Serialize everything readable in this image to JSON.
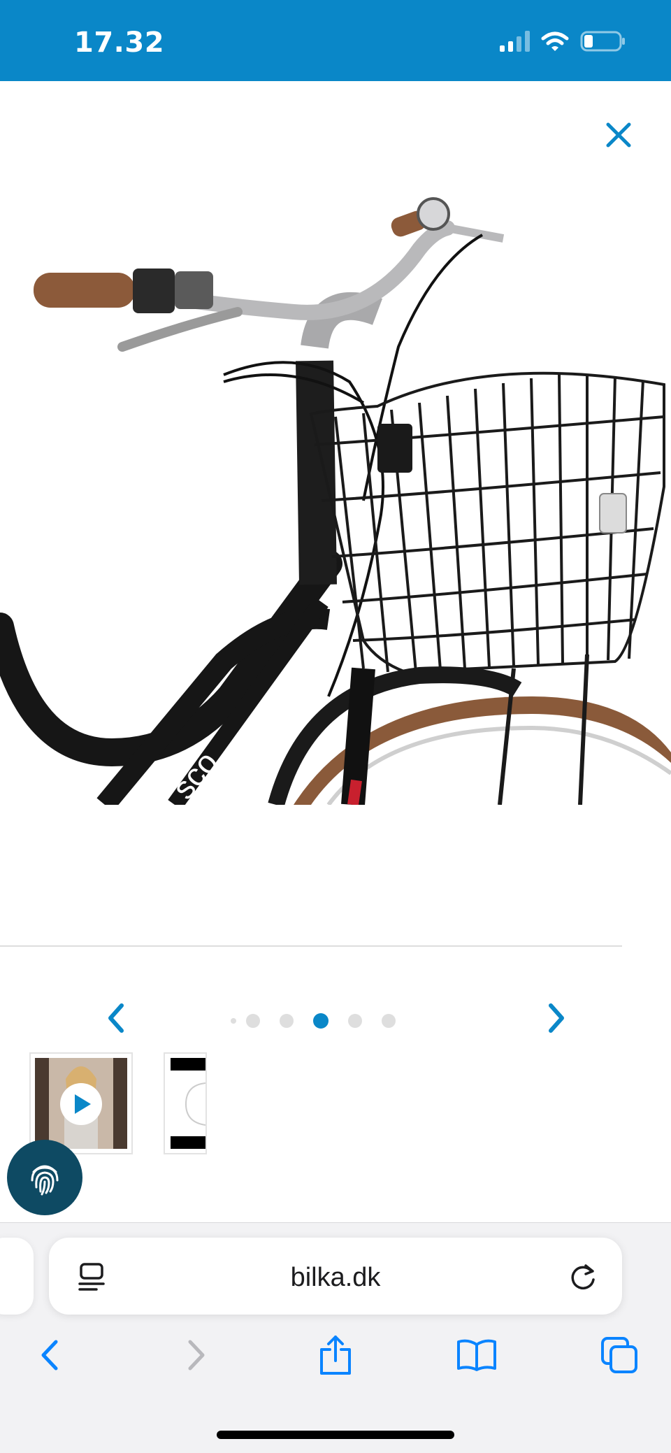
{
  "status_bar": {
    "time": "17.32",
    "background_color": "#0a87c8",
    "signal_bars": 4,
    "signal_bars_active": 2,
    "battery_level": 0.2
  },
  "product": {
    "image_description_icon": "bicycle-with-front-basket",
    "brand_on_frame": "sco"
  },
  "gallery": {
    "dot_count": 5,
    "active_dot_index": 2,
    "accent_color": "#0a87c8"
  },
  "browser": {
    "url": "bilka.dk"
  },
  "toolbar": {
    "icons": [
      "back-icon",
      "forward-icon",
      "share-icon",
      "bookmarks-icon",
      "tabs-icon"
    ]
  }
}
